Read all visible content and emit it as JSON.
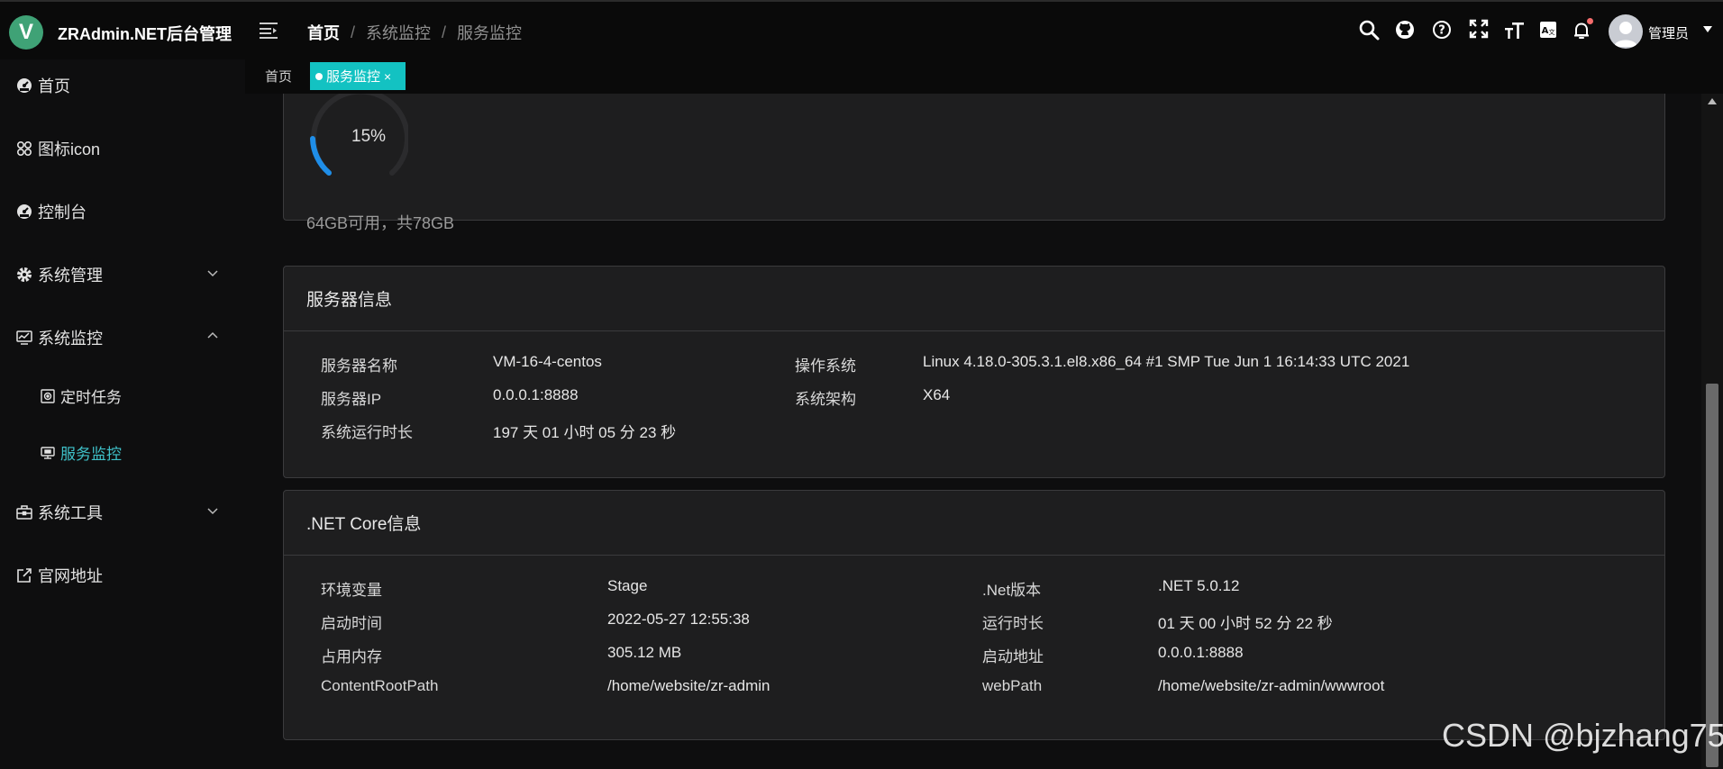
{
  "app": {
    "title": "ZRAdmin.NET后台管理",
    "logo_letter": "V",
    "brand_color": "#3fa276",
    "accent_color": "#13c2c2"
  },
  "header": {
    "breadcrumb": [
      "首页",
      "系统监控",
      "服务监控"
    ],
    "breadcrumb_sep": "/",
    "icons": [
      "search-icon",
      "github-icon",
      "question-icon",
      "fullscreen-icon",
      "font-size-icon",
      "translate-icon",
      "bell-icon"
    ],
    "username": "管理员"
  },
  "sidebar": {
    "items": [
      {
        "label": "首页",
        "icon": "dashboard-icon"
      },
      {
        "label": "图标icon",
        "icon": "grid-icon"
      },
      {
        "label": "控制台",
        "icon": "dashboard-icon"
      },
      {
        "label": "系统管理",
        "icon": "gear-icon",
        "expanded": false
      },
      {
        "label": "系统监控",
        "icon": "monitor-icon",
        "expanded": true,
        "children": [
          {
            "label": "定时任务",
            "icon": "job-icon"
          },
          {
            "label": "服务监控",
            "icon": "server-icon",
            "active": true
          }
        ]
      },
      {
        "label": "系统工具",
        "icon": "toolbox-icon",
        "expanded": false
      },
      {
        "label": "官网地址",
        "icon": "external-link-icon"
      }
    ]
  },
  "tags": [
    {
      "label": "首页"
    },
    {
      "label": "服务监控",
      "active": true,
      "close": "×"
    }
  ],
  "disk": {
    "percent": 15,
    "percent_label": "15%",
    "info": "64GB可用，共78GB"
  },
  "server_info": {
    "title": "服务器信息",
    "rows": [
      {
        "k1": "服务器名称",
        "v1": "VM-16-4-centos",
        "k2": "操作系统",
        "v2": "Linux 4.18.0-305.3.1.el8.x86_64 #1 SMP Tue Jun 1 16:14:33 UTC 2021"
      },
      {
        "k1": "服务器IP",
        "v1": "0.0.0.1:8888",
        "k2": "系统架构",
        "v2": "X64"
      },
      {
        "k1": "系统运行时长",
        "v1": "197 天 01 小时 05 分 23 秒"
      }
    ]
  },
  "net_info": {
    "title": ".NET Core信息",
    "rows": [
      {
        "k1": "环境变量",
        "v1": "Stage",
        "k2": ".Net版本",
        "v2": ".NET 5.0.12"
      },
      {
        "k1": "启动时间",
        "v1": "2022-05-27 12:55:38",
        "k2": "运行时长",
        "v2": "01 天 00 小时 52 分 22 秒"
      },
      {
        "k1": "占用内存",
        "v1": "305.12 MB",
        "k2": "启动地址",
        "v2": "0.0.0.1:8888"
      },
      {
        "k1": "ContentRootPath",
        "v1": "/home/website/zr-admin",
        "k2": "webPath",
        "v2": "/home/website/zr-admin/wwwroot"
      }
    ]
  },
  "watermark": "CSDN @bjzhang75"
}
